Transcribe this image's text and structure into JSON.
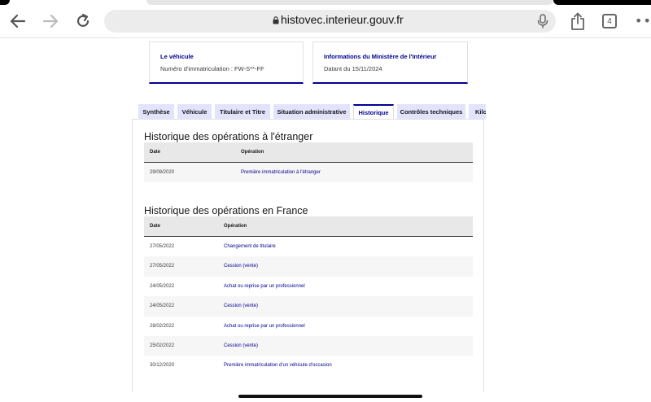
{
  "browser": {
    "url": "histovec.interieur.gouv.fr",
    "tab_count": "4",
    "icons": {
      "back": "back-arrow-icon",
      "forward": "forward-arrow-icon",
      "reload": "reload-icon",
      "lock": "lock-icon",
      "mic": "microphone-icon",
      "share": "share-icon",
      "more": "more-dots-icon"
    }
  },
  "cards": {
    "vehicle": {
      "title": "Le véhicule",
      "text": "Numéro d'immatriculation : FW-S**-FF"
    },
    "ministry": {
      "title": "Informations du Ministère de l'Intérieur",
      "text": "Datant du 15/11/2024"
    }
  },
  "tabs": [
    {
      "label": "Synthèse"
    },
    {
      "label": "Véhicule"
    },
    {
      "label": "Titulaire et Titre"
    },
    {
      "label": "Situation administrative"
    },
    {
      "label": "Historique",
      "active": true
    },
    {
      "label": "Contrôles techniques"
    },
    {
      "label": "Kilo"
    }
  ],
  "abroad": {
    "title": "Historique des opérations à l'étranger",
    "headers": {
      "date": "Date",
      "operation": "Opération"
    },
    "rows": [
      {
        "date": "29/09/2020",
        "operation": "Première immatriculation à l'étranger"
      }
    ]
  },
  "france": {
    "title": "Historique des opérations en France",
    "headers": {
      "date": "Date",
      "operation": "Opération"
    },
    "rows": [
      {
        "date": "27/05/2022",
        "operation": "Changement de titulaire"
      },
      {
        "date": "27/05/2022",
        "operation": "Cession (vente)"
      },
      {
        "date": "24/05/2022",
        "operation": "Achat ou reprise par un professionnel"
      },
      {
        "date": "24/05/2022",
        "operation": "Cession (vente)"
      },
      {
        "date": "28/02/2022",
        "operation": "Achat ou reprise par un professionnel"
      },
      {
        "date": "25/02/2022",
        "operation": "Cession (vente)"
      },
      {
        "date": "30/12/2020",
        "operation": "Première immatriculation d'un véhicule d'occasion"
      }
    ]
  },
  "colors": {
    "accent": "#000091",
    "tab_bg": "#e3e3fd",
    "header_bg": "#e8e8e8",
    "row_alt": "#f6f6f6"
  }
}
